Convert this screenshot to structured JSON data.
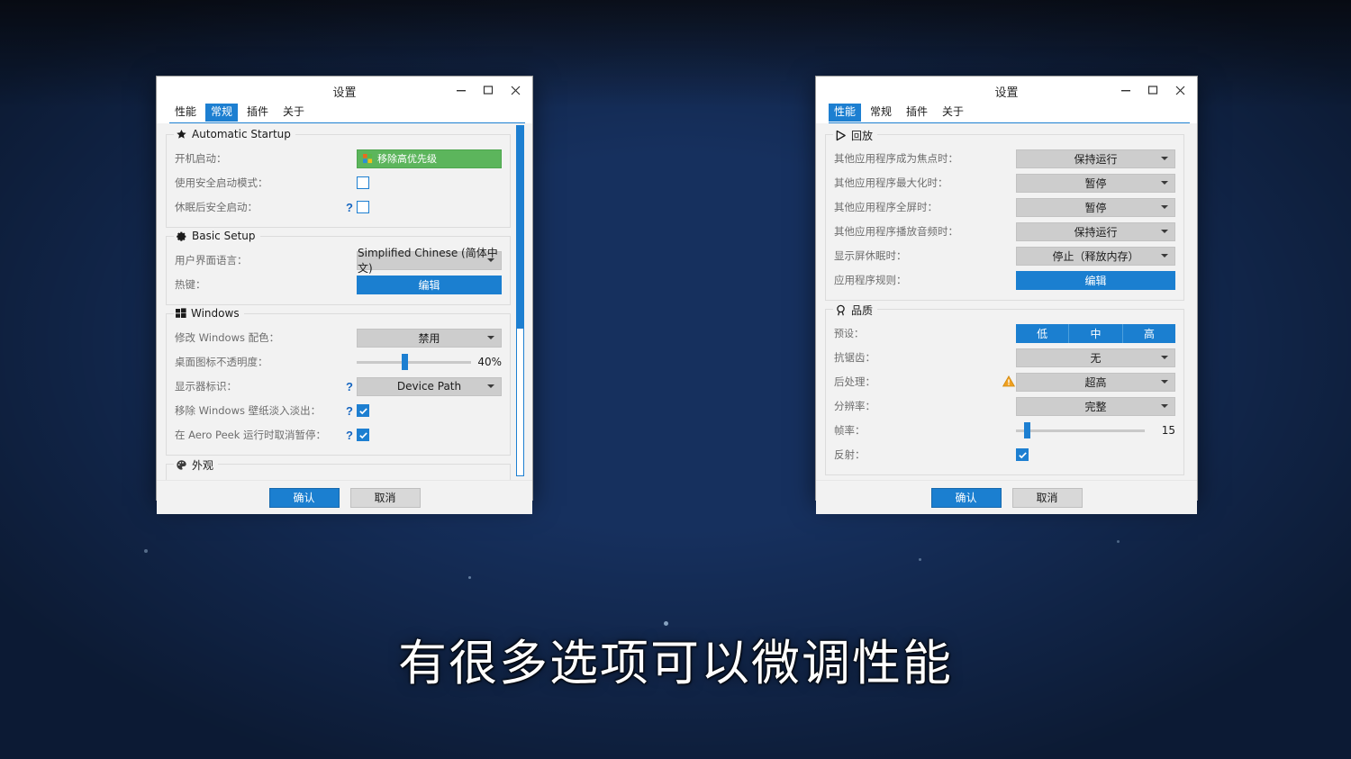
{
  "subtitle": "有很多选项可以微调性能",
  "colors": {
    "accent_blue": "#1b7fd0",
    "green": "#5cb55c",
    "warn_orange": "#f0a020",
    "combo_gray": "#cdcdcd"
  },
  "left_window": {
    "title": "设置",
    "window_buttons": {
      "minimize": "minimize-icon",
      "maximize": "maximize-icon",
      "close": "close-icon"
    },
    "tabs": [
      {
        "label": "性能",
        "active": false
      },
      {
        "label": "常规",
        "active": true
      },
      {
        "label": "插件",
        "active": false
      },
      {
        "label": "关于",
        "active": false
      }
    ],
    "groups": [
      {
        "title": "Automatic Startup",
        "icon": "star-icon",
        "rows": [
          {
            "label": "开机启动：",
            "type": "green-button",
            "value": "移除高优先级",
            "help": false
          },
          {
            "label": "使用安全启动模式：",
            "type": "checkbox",
            "checked": false,
            "help": false
          },
          {
            "label": "休眠后安全启动：",
            "type": "checkbox",
            "checked": false,
            "help": true
          }
        ]
      },
      {
        "title": "Basic Setup",
        "icon": "gear-icon",
        "rows": [
          {
            "label": "用户界面语言：",
            "type": "combo",
            "value": "Simplified Chinese (简体中文)",
            "help": false
          },
          {
            "label": "热键：",
            "type": "blue-button",
            "value": "编辑",
            "help": false
          }
        ]
      },
      {
        "title": "Windows",
        "icon": "windows-icon",
        "rows": [
          {
            "label": "修改 Windows 配色：",
            "type": "combo",
            "value": "禁用",
            "help": false
          },
          {
            "label": "桌面图标不透明度：",
            "type": "slider",
            "value": "40%",
            "percent": 40,
            "help": false
          },
          {
            "label": "显示器标识：",
            "type": "combo",
            "value": "Device Path",
            "help": true
          },
          {
            "label": "移除 Windows 壁纸淡入淡出：",
            "type": "checkbox",
            "checked": true,
            "help": true
          },
          {
            "label": "在 Aero Peek 运行时取消暂停：",
            "type": "checkbox",
            "checked": true,
            "help": true
          }
        ]
      },
      {
        "title": "外观",
        "icon": "palette-icon",
        "rows": []
      }
    ],
    "footer": {
      "ok": "确认",
      "cancel": "取消"
    },
    "scrollbar": {
      "thumb_percent": 58
    }
  },
  "right_window": {
    "title": "设置",
    "window_buttons": {
      "minimize": "minimize-icon",
      "maximize": "maximize-icon",
      "close": "close-icon"
    },
    "tabs": [
      {
        "label": "性能",
        "active": true
      },
      {
        "label": "常规",
        "active": false
      },
      {
        "label": "插件",
        "active": false
      },
      {
        "label": "关于",
        "active": false
      }
    ],
    "groups": [
      {
        "title": "回放",
        "icon": "play-icon",
        "rows": [
          {
            "label": "其他应用程序成为焦点时：",
            "type": "combo",
            "value": "保持运行",
            "help": false
          },
          {
            "label": "其他应用程序最大化时：",
            "type": "combo",
            "value": "暂停",
            "help": false
          },
          {
            "label": "其他应用程序全屏时：",
            "type": "combo",
            "value": "暂停",
            "help": false
          },
          {
            "label": "其他应用程序播放音频时：",
            "type": "combo",
            "value": "保持运行",
            "help": false
          },
          {
            "label": "显示屏休眠时：",
            "type": "combo",
            "value": "停止（释放内存）",
            "help": false
          },
          {
            "label": "应用程序规则：",
            "type": "blue-button",
            "value": "编辑",
            "help": false
          }
        ]
      },
      {
        "title": "品质",
        "icon": "quality-icon",
        "rows": [
          {
            "label": "预设：",
            "type": "segmented",
            "options": [
              "低",
              "中",
              "高"
            ],
            "help": false
          },
          {
            "label": "抗锯齿：",
            "type": "combo",
            "value": "无",
            "help": false
          },
          {
            "label": "后处理：",
            "type": "combo",
            "value": "超高",
            "warn": true
          },
          {
            "label": "分辨率：",
            "type": "combo",
            "value": "完整",
            "help": false
          },
          {
            "label": "帧率：",
            "type": "slider",
            "value": "15",
            "percent": 6,
            "help": false
          },
          {
            "label": "反射：",
            "type": "checkbox",
            "checked": true,
            "help": false
          }
        ]
      }
    ],
    "footer": {
      "ok": "确认",
      "cancel": "取消"
    }
  }
}
